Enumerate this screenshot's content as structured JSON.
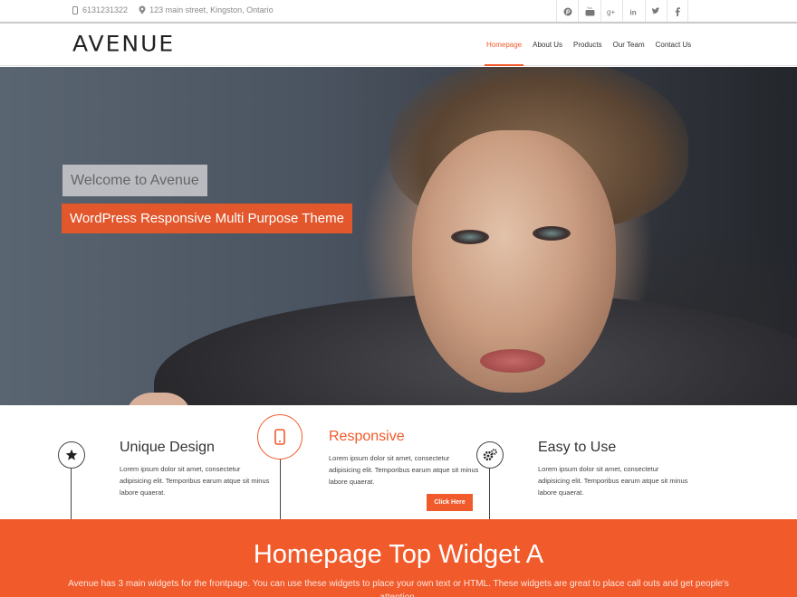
{
  "topbar": {
    "phone": "6131231322",
    "address": "123 main street, Kingston, Ontario",
    "socials": [
      "pinterest-icon",
      "youtube-icon",
      "googleplus-icon",
      "linkedin-icon",
      "twitter-icon",
      "facebook-icon"
    ],
    "social_glyphs": [
      "⊚",
      "▶",
      "g+",
      "in",
      "t",
      "f"
    ]
  },
  "header": {
    "logo": "AVENUE",
    "nav": [
      {
        "label": "Homepage",
        "active": true
      },
      {
        "label": "About Us",
        "active": false
      },
      {
        "label": "Products",
        "active": false
      },
      {
        "label": "Our Team",
        "active": false
      },
      {
        "label": "Contact Us",
        "active": false
      }
    ]
  },
  "hero": {
    "title": "Welcome to Avenue",
    "subtitle": "WordPress Responsive Multi Purpose Theme"
  },
  "features": [
    {
      "title": "Unique Design",
      "icon": "star-icon",
      "text": "Lorem ipsum dolor sit amet, consectetur adipisicing elit. Temporibus earum atque sit minus labore quaerat."
    },
    {
      "title": "Responsive",
      "icon": "mobile-icon",
      "text": "Lorem ipsum dolor sit amet, consectetur adipisicing elit. Temporibus earum atque sit minus labore quaerat.",
      "button": "Click Here"
    },
    {
      "title": "Easy to Use",
      "icon": "gears-icon",
      "text": "Lorem ipsum dolor sit amet, consectetur adipisicing elit. Temporibus earum atque sit minus labore quaerat."
    }
  ],
  "widget": {
    "title": "Homepage Top Widget A",
    "text": "Avenue has 3 main widgets for the frontpage. You can use these widgets to place your own text or HTML. These widgets are great to place call outs and get people's attention."
  },
  "colors": {
    "accent": "#f15a2b",
    "dark": "#333333"
  }
}
